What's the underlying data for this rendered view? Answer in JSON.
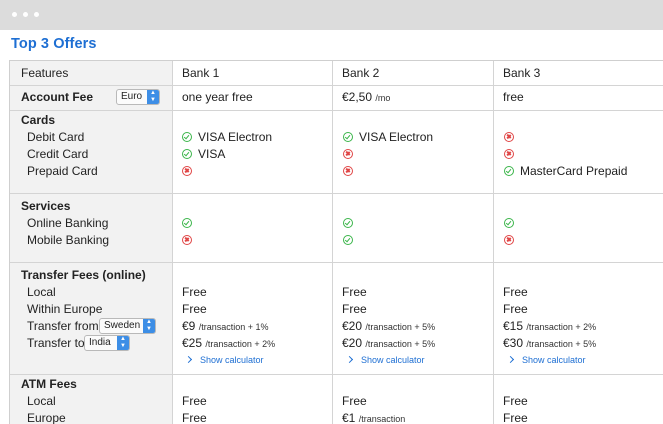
{
  "title": "Top 3 Offers",
  "header": {
    "features": "Features",
    "bank1": "Bank 1",
    "bank2": "Bank 2",
    "bank3": "Bank 3"
  },
  "account_fee": {
    "label": "Account Fee",
    "currency_select": "Euro",
    "bank1": "one year free",
    "bank2_amount": "€2,50",
    "bank2_unit": "/mo",
    "bank3": "free"
  },
  "cards": {
    "heading": "Cards",
    "debit_label": "Debit Card",
    "credit_label": "Credit Card",
    "prepaid_label": "Prepaid Card",
    "bank1_debit": "VISA Electron",
    "bank1_credit": "VISA",
    "bank2_debit": "VISA Electron",
    "bank3_prepaid": "MasterCard Prepaid"
  },
  "services": {
    "heading": "Services",
    "online_label": "Online Banking",
    "mobile_label": "Mobile Banking"
  },
  "transfer": {
    "heading": "Transfer Fees (online)",
    "local_label": "Local",
    "europe_label": "Within Europe",
    "from_label": "Transfer from",
    "from_select": "Sweden",
    "to_label": "Transfer to",
    "to_select": "India",
    "free": "Free",
    "bank1_from": "€9",
    "bank1_from_detail": "/transaction + 1%",
    "bank1_to": "€25",
    "bank1_to_detail": "/transaction + 2%",
    "bank2_from": "€20",
    "bank2_from_detail": "/transaction + 5%",
    "bank2_to": "€20",
    "bank2_to_detail": "/transaction + 5%",
    "bank3_from": "€15",
    "bank3_from_detail": "/transaction + 2%",
    "bank3_to": "€30",
    "bank3_to_detail": "/transaction + 5%",
    "calculator": "Show calculator"
  },
  "atm": {
    "heading": "ATM Fees",
    "local_label": "Local",
    "europe_label": "Europe",
    "free": "Free",
    "bank2_europe": "€1",
    "bank2_europe_unit": "/transaction"
  },
  "status_icons": {
    "available": "check-circle-icon",
    "unavailable": "cross-circle-icon"
  },
  "colors": {
    "accent": "#1e6fd3",
    "check": "#3bb54a",
    "cross": "#e04646",
    "feature_column": "#f2f2f2"
  }
}
